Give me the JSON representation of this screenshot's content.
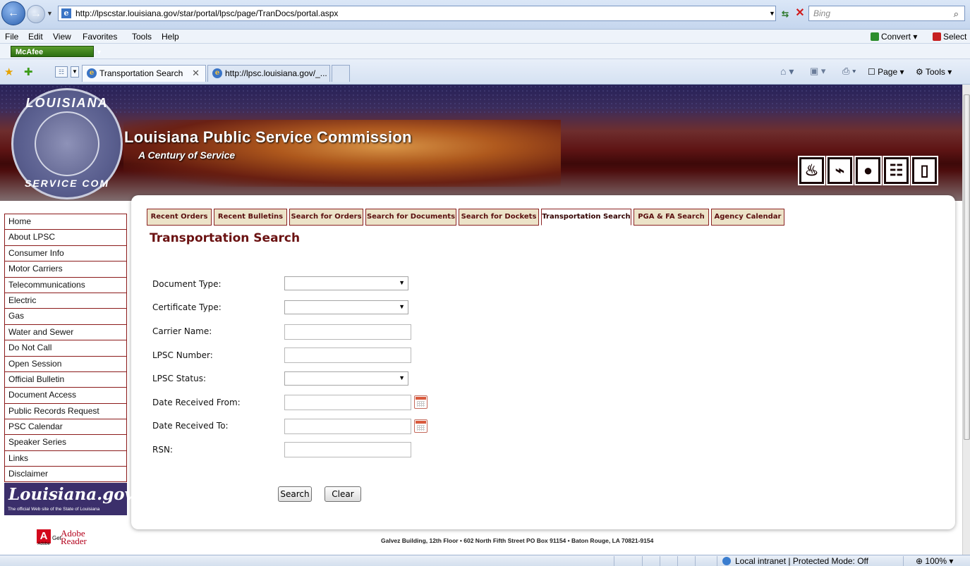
{
  "browser": {
    "url": "http://lpscstar.louisiana.gov/star/portal/lpsc/page/TranDocs/portal.aspx",
    "search_placeholder": "Bing",
    "menus": [
      "File",
      "Edit",
      "View",
      "Favorites",
      "Tools",
      "Help"
    ],
    "convert_label": "Convert",
    "select_label": "Select",
    "mcafee_label": "McAfee",
    "tabs": [
      {
        "label": "Transportation Search"
      },
      {
        "label": "http://lpsc.louisiana.gov/_..."
      }
    ],
    "command_bar": {
      "page_label": "Page",
      "tools_label": "Tools"
    },
    "status": {
      "zone": "Local intranet | Protected Mode: Off",
      "zoom": "100%"
    }
  },
  "site": {
    "seal_top": "LOUISIANA",
    "seal_bottom": "SERVICE COM",
    "title": "Louisiana Public Service Commission",
    "tagline": "A Century of Service",
    "nav_items": [
      "Home",
      "About LPSC",
      "Consumer Info",
      "Motor Carriers",
      "Telecommunications",
      "Electric",
      "Gas",
      "Water and Sewer",
      "Do Not Call",
      "Open Session",
      "Official Bulletin",
      "Document Access",
      "Public Records Request",
      "PSC Calendar",
      "Speaker Series",
      "Links",
      "Disclaimer"
    ],
    "la_gov": {
      "title": "Louisiana.gov",
      "subtitle": "The official Web site of the State of Louisiana"
    },
    "adobe": {
      "brand": "Adobe",
      "get": "Get",
      "product": "Adobe Reader"
    },
    "tabs": [
      "Recent Orders",
      "Recent Bulletins",
      "Search for Orders",
      "Search for Documents",
      "Search for Dockets",
      "Transportation Search",
      "PGA & FA Search",
      "Agency Calendar"
    ],
    "active_tab": "Transportation Search",
    "footer": "Galvez Building, 12th Floor • 602 North Fifth Street PO Box 91154 • Baton Rouge, LA  70821-9154"
  },
  "form": {
    "title": "Transportation Search",
    "fields": {
      "document_type": {
        "label": "Document Type:",
        "value": ""
      },
      "certificate_type": {
        "label": "Certificate Type:",
        "value": ""
      },
      "carrier_name": {
        "label": "Carrier Name:",
        "value": ""
      },
      "lpsc_number": {
        "label": "LPSC Number:",
        "value": ""
      },
      "lpsc_status": {
        "label": "LPSC Status:",
        "value": ""
      },
      "date_from": {
        "label": "Date Received From:",
        "value": ""
      },
      "date_to": {
        "label": "Date Received To:",
        "value": ""
      },
      "rsn": {
        "label": "RSN:",
        "value": ""
      }
    },
    "search_label": "Search",
    "clear_label": "Clear"
  }
}
